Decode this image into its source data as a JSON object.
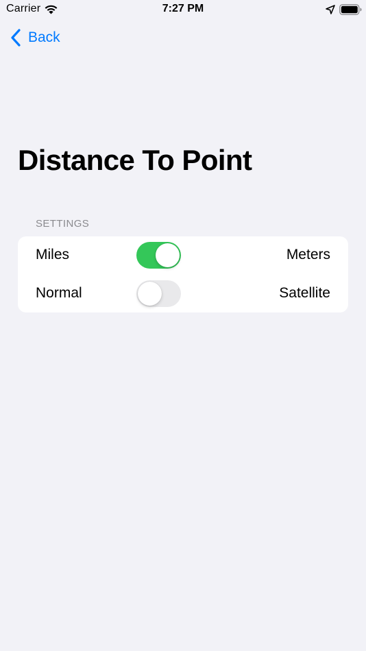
{
  "status_bar": {
    "carrier": "Carrier",
    "time": "7:27 PM"
  },
  "nav": {
    "back_label": "Back"
  },
  "page": {
    "title": "Distance To Point"
  },
  "settings": {
    "header": "SETTINGS",
    "rows": [
      {
        "left_label": "Miles",
        "right_label": "Meters",
        "toggle_on": true
      },
      {
        "left_label": "Normal",
        "right_label": "Satellite",
        "toggle_on": false
      }
    ]
  },
  "colors": {
    "accent": "#007aff",
    "toggle_on": "#34c759",
    "toggle_off": "#e9e9eb",
    "background": "#f2f2f7"
  },
  "icons": {
    "wifi": "wifi-icon",
    "location": "location-arrow-icon",
    "battery": "battery-icon",
    "back": "chevron-left-icon"
  }
}
